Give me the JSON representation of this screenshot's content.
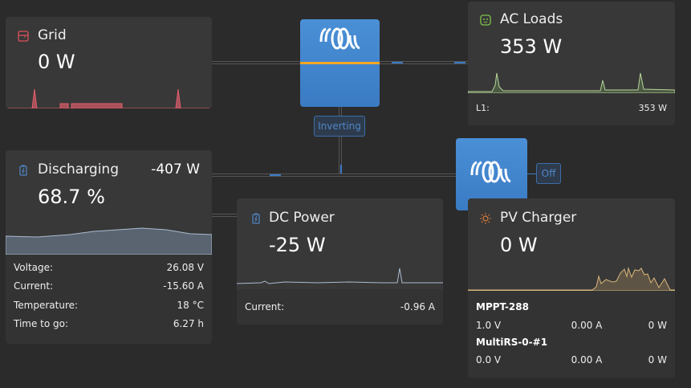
{
  "grid": {
    "title": "Grid",
    "value": "0 W",
    "icon": "grid-icon",
    "color": "#e0525c"
  },
  "inverter": {
    "status": "Inverting",
    "accent": "#f5a623"
  },
  "ac_loads": {
    "title": "AC Loads",
    "value": "353 W",
    "icon": "plug-icon",
    "color": "#7fc34a",
    "rows": [
      {
        "label": "L1:",
        "value": "353 W"
      }
    ]
  },
  "battery": {
    "title": "Discharging",
    "power": "-407 W",
    "value": "68.7 %",
    "icon": "battery-icon",
    "rows": [
      {
        "label": "Voltage:",
        "value": "26.08 V"
      },
      {
        "label": "Current:",
        "value": "-15.60 A"
      },
      {
        "label": "Temperature:",
        "value": "18 °C"
      },
      {
        "label": "Time to go:",
        "value": "6.27 h"
      }
    ]
  },
  "dc_power": {
    "title": "DC Power",
    "value": "-25 W",
    "icon": "battery-icon",
    "rows": [
      {
        "label": "Current:",
        "value": "-0.96 A"
      }
    ]
  },
  "charger": {
    "status": "Off"
  },
  "pv": {
    "title": "PV Charger",
    "value": "0 W",
    "icon": "sun-icon",
    "color": "#e07b39",
    "devices": [
      {
        "name": "MPPT-288",
        "voltage": "1.0 V",
        "current": "0.00 A",
        "power": "0 W"
      },
      {
        "name": "MultiRS-0-#1",
        "voltage": "0.0 V",
        "current": "0.00 A",
        "power": "0 W"
      }
    ]
  }
}
